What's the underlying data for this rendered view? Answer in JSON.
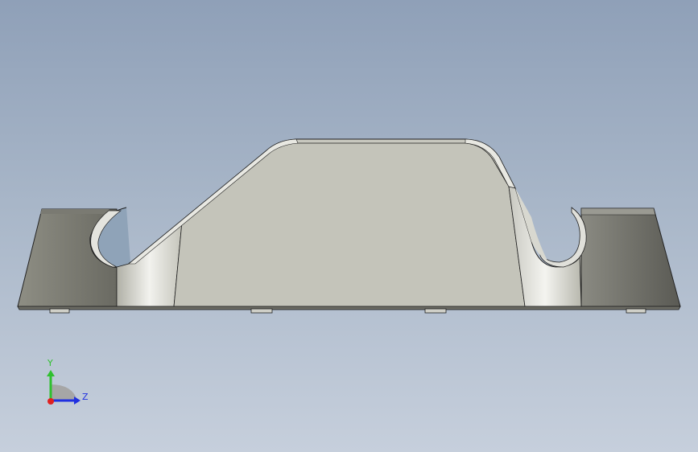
{
  "viewport": {
    "background_top": "#8fa0b8",
    "background_bottom": "#c6cfdc"
  },
  "model": {
    "face_color": "#c6c6bc",
    "edge_color": "#1e1e1e"
  },
  "triad": {
    "y_label": "Y",
    "z_label": "Z",
    "y_color": "#2fc02f",
    "z_color": "#2030e0",
    "x_color": "#e02020"
  }
}
